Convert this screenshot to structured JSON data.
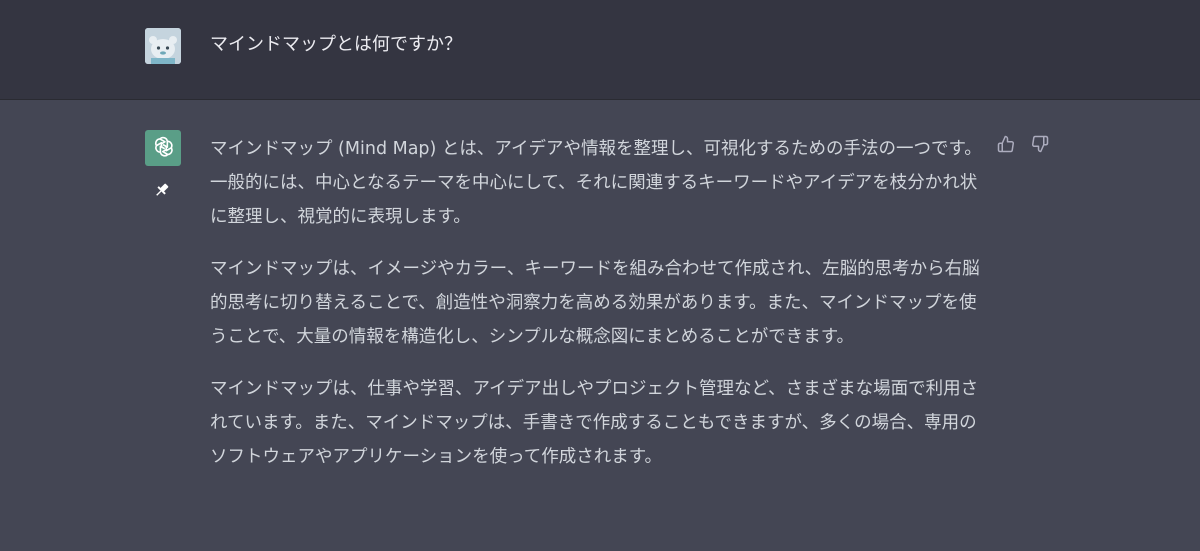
{
  "user_message": {
    "text": "マインドマップとは何ですか？",
    "avatar_icon": "user-avatar-icon"
  },
  "assistant_message": {
    "avatar_icon": "openai-logo-icon",
    "paragraphs": [
      "マインドマップ (Mind Map) とは、アイデアや情報を整理し、可視化するための手法の一つです。一般的には、中心となるテーマを中心にして、それに関連するキーワードやアイデアを枝分かれ状に整理し、視覚的に表現します。",
      "マインドマップは、イメージやカラー、キーワードを組み合わせて作成され、左脳的思考から右脳的思考に切り替えることで、創造性や洞察力を高める効果があります。また、マインドマップを使うことで、大量の情報を構造化し、シンプルな概念図にまとめることができます。",
      "マインドマップは、仕事や学習、アイデア出しやプロジェクト管理など、さまざまな場面で利用されています。また、マインドマップは、手書きで作成することもできますが、多くの場合、専用のソフトウェアやアプリケーションを使って作成されます。"
    ]
  },
  "colors": {
    "user_bg": "#343541",
    "assistant_bg": "#444654",
    "text": "#d1d5db",
    "bot_avatar": "#5a9e87"
  }
}
